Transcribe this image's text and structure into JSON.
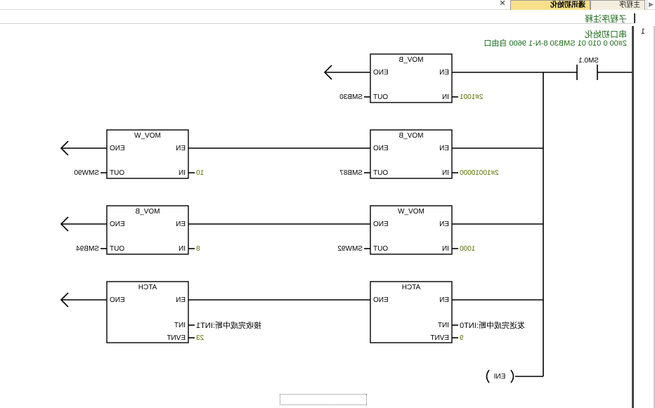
{
  "tabs": {
    "main_label": "主程序",
    "active_label": "通讯初始化"
  },
  "subroutine_comment": "子程序注释",
  "network": {
    "number": "1",
    "title": "串口初始化",
    "comment": "2#00 0 010 01 SMB30  8-N-1 9600 自由口"
  },
  "contact": {
    "address": "SM0.1"
  },
  "blocks": [
    {
      "name": "MOV_B",
      "en": "EN",
      "eno": "ENO",
      "in_label": "IN",
      "out_label": "OUT",
      "in_value": "2#1001",
      "out_value": "SMB30"
    },
    {
      "name": "MOV_B",
      "en": "EN",
      "eno": "ENO",
      "in_label": "IN",
      "out_label": "OUT",
      "in_value": "2#10010000",
      "out_value": "SMB87"
    },
    {
      "name": "MOV_W",
      "en": "EN",
      "eno": "ENO",
      "in_label": "IN",
      "out_label": "OUT",
      "in_value": "10",
      "out_value": "SMW90"
    },
    {
      "name": "MOV_W",
      "en": "EN",
      "eno": "ENO",
      "in_label": "IN",
      "out_label": "OUT",
      "in_value": "1000",
      "out_value": "SMW92"
    },
    {
      "name": "MOV_B",
      "en": "EN",
      "eno": "ENO",
      "in_label": "IN",
      "out_label": "OUT",
      "in_value": "8",
      "out_value": "SMB94"
    },
    {
      "name": "ATCH",
      "en": "EN",
      "eno": "ENO",
      "int_label": "INT",
      "evnt_label": "EVNT",
      "int_value": "发送完成中断:INT0",
      "evnt_value": "9"
    },
    {
      "name": "ATCH",
      "en": "EN",
      "eno": "ENO",
      "int_label": "INT",
      "evnt_label": "EVNT",
      "int_value": "接收完成中断:INT1",
      "evnt_value": "23"
    }
  ],
  "coil": {
    "label": "ENI"
  },
  "colors": {
    "comment_green": "#1a6b1a",
    "constant_olive": "#5b6f00",
    "active_tab": "#f7e08a"
  },
  "icons": {
    "close": "close-icon",
    "scroll": "tab-scroll-arrow-icon"
  }
}
